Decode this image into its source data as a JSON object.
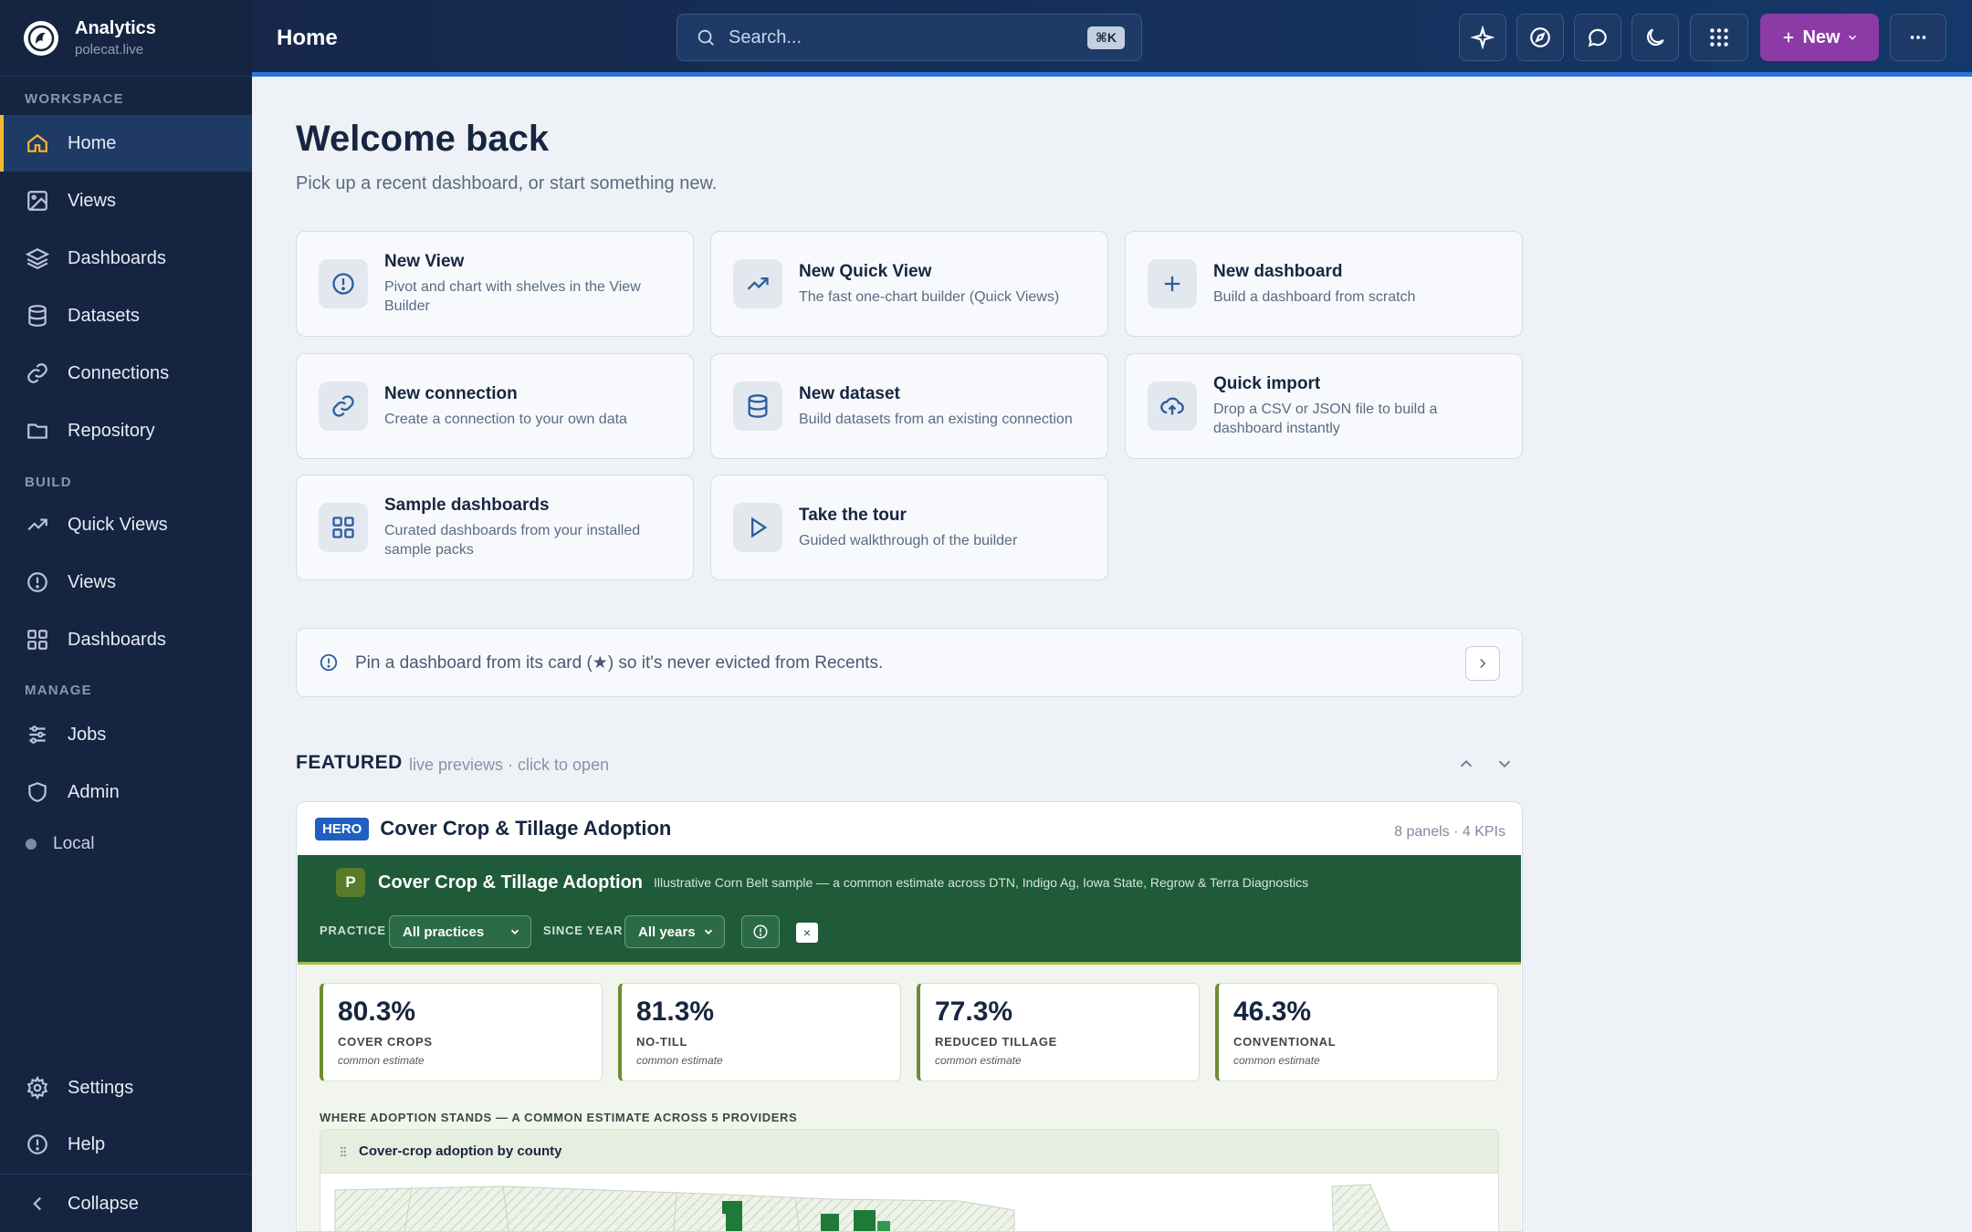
{
  "app": {
    "name": "Analytics",
    "host": "polecat.live"
  },
  "sidebar": {
    "sections": {
      "workspace": "WORKSPACE",
      "build": "BUILD",
      "manage": "MANAGE"
    },
    "workspace_items": [
      {
        "label": "Home",
        "icon": "home-icon",
        "active": true
      },
      {
        "label": "Views",
        "icon": "image-icon"
      },
      {
        "label": "Dashboards",
        "icon": "layers-icon"
      },
      {
        "label": "Datasets",
        "icon": "database-icon"
      },
      {
        "label": "Connections",
        "icon": "link-icon"
      },
      {
        "label": "Repository",
        "icon": "folder-icon"
      }
    ],
    "build_items": [
      {
        "label": "Quick Views",
        "icon": "trend-icon"
      },
      {
        "label": "Views",
        "icon": "info-circle-icon"
      },
      {
        "label": "Dashboards",
        "icon": "grid-icon"
      }
    ],
    "manage_items": [
      {
        "label": "Jobs",
        "icon": "sliders-icon"
      },
      {
        "label": "Admin",
        "icon": "shield-icon"
      }
    ],
    "local_label": "Local",
    "settings_label": "Settings",
    "help_label": "Help",
    "collapse_label": "Collapse"
  },
  "topbar": {
    "title": "Home",
    "search_placeholder": "Search...",
    "search_shortcut": "⌘K",
    "new_label": "New"
  },
  "main": {
    "welcome": "Welcome back",
    "subtitle": "Pick up a recent dashboard, or start something new.",
    "cards": [
      {
        "title": "New View",
        "desc": "Pivot and chart with shelves in the View Builder",
        "icon": "info-circle-icon"
      },
      {
        "title": "New Quick View",
        "desc": "The fast one-chart builder (Quick Views)",
        "icon": "trend-icon"
      },
      {
        "title": "New dashboard",
        "desc": "Build a dashboard from scratch",
        "icon": "plus-icon"
      },
      {
        "title": "New connection",
        "desc": "Create a connection to your own data",
        "icon": "link-icon"
      },
      {
        "title": "New dataset",
        "desc": "Build datasets from an existing connection",
        "icon": "database-icon"
      },
      {
        "title": "Quick import",
        "desc": "Drop a CSV or JSON file to build a dashboard instantly",
        "icon": "upload-cloud-icon"
      },
      {
        "title": "Sample dashboards",
        "desc": "Curated dashboards from your installed sample packs",
        "icon": "grid-icon"
      },
      {
        "title": "Take the tour",
        "desc": "Guided walkthrough of the builder",
        "icon": "play-icon"
      }
    ],
    "pin_hint": "Pin a dashboard from its card (★) so it's never evicted from Recents.",
    "featured": {
      "title": "FEATURED",
      "subtitle": "live previews · click to open"
    },
    "hero": {
      "badge": "HERO",
      "title": "Cover Crop & Tillage Adoption",
      "meta": "8 panels · 4 KPIs",
      "dashboard": {
        "logo_letter": "P",
        "title": "Cover Crop & Tillage Adoption",
        "description": "Illustrative Corn Belt sample — a common estimate across DTN, Indigo Ag, Iowa State, Regrow & Terra Diagnostics",
        "filters": {
          "practice_label": "PRACTICE",
          "practice_value": "All practices",
          "since_label": "SINCE YEAR",
          "since_value": "All years",
          "clear_label": "×"
        },
        "kpis": [
          {
            "value": "80.3%",
            "label": "COVER CROPS",
            "note": "common estimate"
          },
          {
            "value": "81.3%",
            "label": "NO-TILL",
            "note": "common estimate"
          },
          {
            "value": "77.3%",
            "label": "REDUCED TILLAGE",
            "note": "common estimate"
          },
          {
            "value": "46.3%",
            "label": "CONVENTIONAL",
            "note": "common estimate"
          }
        ],
        "section_title": "WHERE ADOPTION STANDS — A COMMON ESTIMATE ACROSS 5 PROVIDERS",
        "map_panel_title": "Cover-crop adoption by county"
      }
    }
  },
  "colors": {
    "sidebar_bg": "#152440",
    "accent": "#f5b82e",
    "topbar_accent": "#2e73d8",
    "new_button": "#8b3aa6",
    "dashboard_green": "#1f5a39"
  }
}
